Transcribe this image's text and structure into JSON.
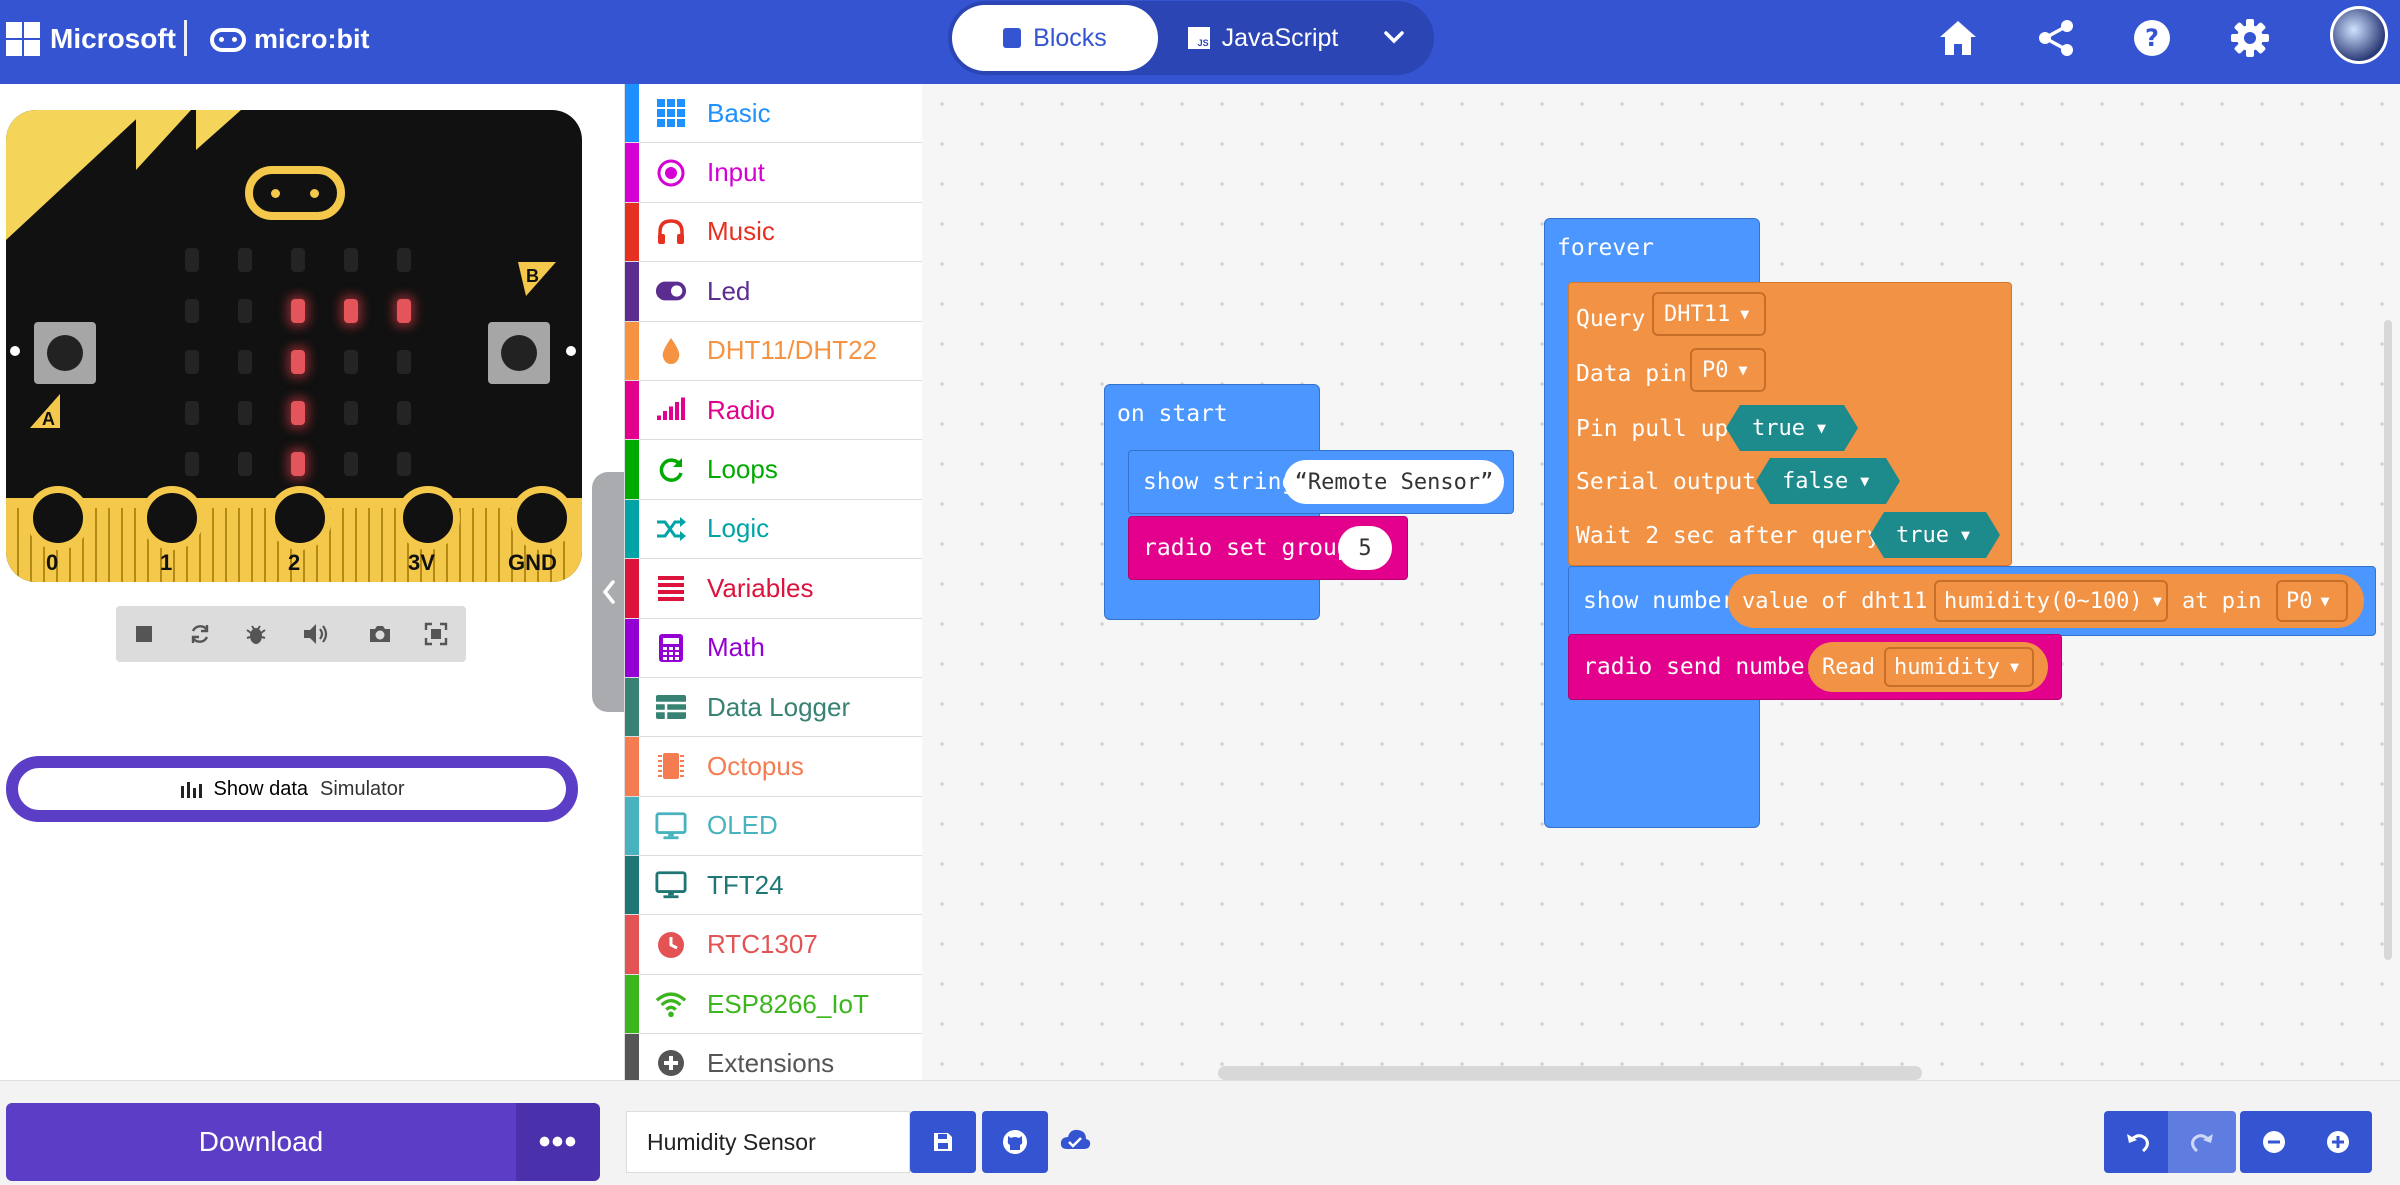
{
  "header": {
    "brand": "Microsoft",
    "product": "micro:bit",
    "tabs": {
      "blocks": "Blocks",
      "javascript": "JavaScript"
    },
    "accent": "#3454d1"
  },
  "simulator": {
    "pins": [
      "0",
      "1",
      "2",
      "3V",
      "GND"
    ],
    "button_a": "A",
    "button_b": "B",
    "show_data": {
      "label": "Show data",
      "sub": "Simulator"
    }
  },
  "toolbox": {
    "categories": [
      {
        "label": "Basic",
        "color": "#1e90ff",
        "icon": "grid-icon"
      },
      {
        "label": "Input",
        "color": "#d400d4",
        "icon": "target-icon"
      },
      {
        "label": "Music",
        "color": "#e63022",
        "icon": "headphones-icon"
      },
      {
        "label": "Led",
        "color": "#5c2d91",
        "icon": "toggle-icon"
      },
      {
        "label": "DHT11/DHT22",
        "color": "#f59342",
        "icon": "drop-icon"
      },
      {
        "label": "Radio",
        "color": "#e3008c",
        "icon": "signal-icon"
      },
      {
        "label": "Loops",
        "color": "#00aa00",
        "icon": "refresh-icon"
      },
      {
        "label": "Logic",
        "color": "#00a4a6",
        "icon": "shuffle-icon"
      },
      {
        "label": "Variables",
        "color": "#dc143c",
        "icon": "lines-icon"
      },
      {
        "label": "Math",
        "color": "#9400d3",
        "icon": "calculator-icon"
      },
      {
        "label": "Data Logger",
        "color": "#378273",
        "icon": "table-icon"
      },
      {
        "label": "Octopus",
        "color": "#f47c50",
        "icon": "chip-icon"
      },
      {
        "label": "OLED",
        "color": "#48b3be",
        "icon": "monitor-icon"
      },
      {
        "label": "TFT24",
        "color": "#1e7775",
        "icon": "monitor-icon"
      },
      {
        "label": "RTC1307",
        "color": "#e35353",
        "icon": "clock-icon"
      },
      {
        "label": "ESP8266_IoT",
        "color": "#3cb51e",
        "icon": "wifi-icon"
      },
      {
        "label": "Extensions",
        "color": "#555555",
        "icon": "plus-circle-icon"
      }
    ]
  },
  "workspace": {
    "on_start": {
      "hat": "on start",
      "show_string": {
        "label": "show string",
        "value": "Remote Sensor",
        "open_quote": "“",
        "close_quote": "”"
      },
      "radio_set_group": {
        "label": "radio set group",
        "value": "5"
      }
    },
    "forever": {
      "hat": "forever",
      "query": {
        "label": "Query",
        "value": "DHT11"
      },
      "data_pin": {
        "label": "Data pin",
        "value": "P0"
      },
      "pin_pull_up": {
        "label": "Pin pull up",
        "value": "true"
      },
      "serial_output": {
        "label": "Serial output",
        "value": "false"
      },
      "wait": {
        "label": "Wait 2 sec after query",
        "value": "true"
      },
      "show_number": {
        "label": "show number",
        "reporter": "value of dht11",
        "prop": "humidity(0~100)",
        "at": "at pin",
        "pin": "P0"
      },
      "radio_send": {
        "label": "radio send number",
        "read": "Read",
        "value": "humidity"
      }
    }
  },
  "footer": {
    "download": "Download",
    "more": "•••",
    "project_name": "Humidity Sensor"
  }
}
